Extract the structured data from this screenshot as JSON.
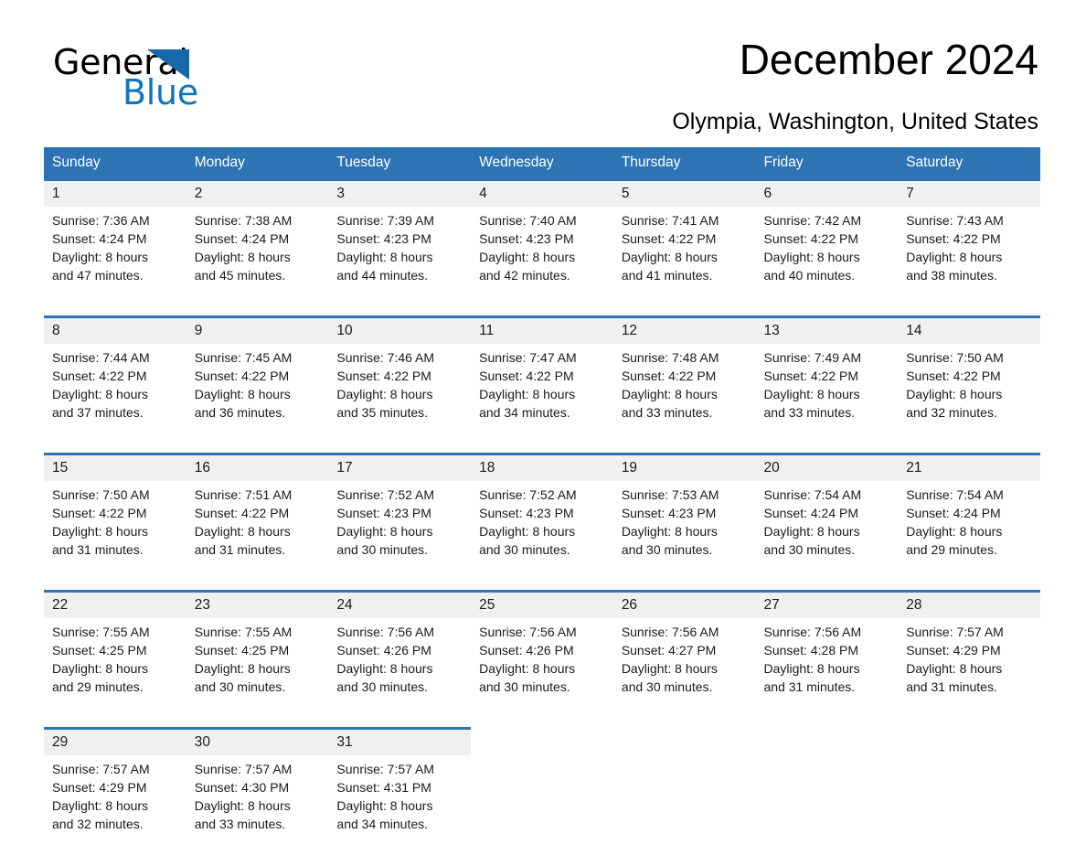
{
  "brand": {
    "word_one": "General",
    "word_two": "Blue",
    "triangle_color": "#0f75bc",
    "logo_icon": "triangle-icon"
  },
  "header": {
    "title": "December 2024",
    "location": "Olympia, Washington, United States"
  },
  "calendar": {
    "accent_color": "#2e74b5",
    "daynum_bg": "#f0f0f0",
    "weekday_headers": [
      "Sunday",
      "Monday",
      "Tuesday",
      "Wednesday",
      "Thursday",
      "Friday",
      "Saturday"
    ],
    "weeks": [
      [
        {
          "day": "1",
          "sunrise": "Sunrise: 7:36 AM",
          "sunset": "Sunset: 4:24 PM",
          "daylight_1": "Daylight: 8 hours",
          "daylight_2": "and 47 minutes."
        },
        {
          "day": "2",
          "sunrise": "Sunrise: 7:38 AM",
          "sunset": "Sunset: 4:24 PM",
          "daylight_1": "Daylight: 8 hours",
          "daylight_2": "and 45 minutes."
        },
        {
          "day": "3",
          "sunrise": "Sunrise: 7:39 AM",
          "sunset": "Sunset: 4:23 PM",
          "daylight_1": "Daylight: 8 hours",
          "daylight_2": "and 44 minutes."
        },
        {
          "day": "4",
          "sunrise": "Sunrise: 7:40 AM",
          "sunset": "Sunset: 4:23 PM",
          "daylight_1": "Daylight: 8 hours",
          "daylight_2": "and 42 minutes."
        },
        {
          "day": "5",
          "sunrise": "Sunrise: 7:41 AM",
          "sunset": "Sunset: 4:22 PM",
          "daylight_1": "Daylight: 8 hours",
          "daylight_2": "and 41 minutes."
        },
        {
          "day": "6",
          "sunrise": "Sunrise: 7:42 AM",
          "sunset": "Sunset: 4:22 PM",
          "daylight_1": "Daylight: 8 hours",
          "daylight_2": "and 40 minutes."
        },
        {
          "day": "7",
          "sunrise": "Sunrise: 7:43 AM",
          "sunset": "Sunset: 4:22 PM",
          "daylight_1": "Daylight: 8 hours",
          "daylight_2": "and 38 minutes."
        }
      ],
      [
        {
          "day": "8",
          "sunrise": "Sunrise: 7:44 AM",
          "sunset": "Sunset: 4:22 PM",
          "daylight_1": "Daylight: 8 hours",
          "daylight_2": "and 37 minutes."
        },
        {
          "day": "9",
          "sunrise": "Sunrise: 7:45 AM",
          "sunset": "Sunset: 4:22 PM",
          "daylight_1": "Daylight: 8 hours",
          "daylight_2": "and 36 minutes."
        },
        {
          "day": "10",
          "sunrise": "Sunrise: 7:46 AM",
          "sunset": "Sunset: 4:22 PM",
          "daylight_1": "Daylight: 8 hours",
          "daylight_2": "and 35 minutes."
        },
        {
          "day": "11",
          "sunrise": "Sunrise: 7:47 AM",
          "sunset": "Sunset: 4:22 PM",
          "daylight_1": "Daylight: 8 hours",
          "daylight_2": "and 34 minutes."
        },
        {
          "day": "12",
          "sunrise": "Sunrise: 7:48 AM",
          "sunset": "Sunset: 4:22 PM",
          "daylight_1": "Daylight: 8 hours",
          "daylight_2": "and 33 minutes."
        },
        {
          "day": "13",
          "sunrise": "Sunrise: 7:49 AM",
          "sunset": "Sunset: 4:22 PM",
          "daylight_1": "Daylight: 8 hours",
          "daylight_2": "and 33 minutes."
        },
        {
          "day": "14",
          "sunrise": "Sunrise: 7:50 AM",
          "sunset": "Sunset: 4:22 PM",
          "daylight_1": "Daylight: 8 hours",
          "daylight_2": "and 32 minutes."
        }
      ],
      [
        {
          "day": "15",
          "sunrise": "Sunrise: 7:50 AM",
          "sunset": "Sunset: 4:22 PM",
          "daylight_1": "Daylight: 8 hours",
          "daylight_2": "and 31 minutes."
        },
        {
          "day": "16",
          "sunrise": "Sunrise: 7:51 AM",
          "sunset": "Sunset: 4:22 PM",
          "daylight_1": "Daylight: 8 hours",
          "daylight_2": "and 31 minutes."
        },
        {
          "day": "17",
          "sunrise": "Sunrise: 7:52 AM",
          "sunset": "Sunset: 4:23 PM",
          "daylight_1": "Daylight: 8 hours",
          "daylight_2": "and 30 minutes."
        },
        {
          "day": "18",
          "sunrise": "Sunrise: 7:52 AM",
          "sunset": "Sunset: 4:23 PM",
          "daylight_1": "Daylight: 8 hours",
          "daylight_2": "and 30 minutes."
        },
        {
          "day": "19",
          "sunrise": "Sunrise: 7:53 AM",
          "sunset": "Sunset: 4:23 PM",
          "daylight_1": "Daylight: 8 hours",
          "daylight_2": "and 30 minutes."
        },
        {
          "day": "20",
          "sunrise": "Sunrise: 7:54 AM",
          "sunset": "Sunset: 4:24 PM",
          "daylight_1": "Daylight: 8 hours",
          "daylight_2": "and 30 minutes."
        },
        {
          "day": "21",
          "sunrise": "Sunrise: 7:54 AM",
          "sunset": "Sunset: 4:24 PM",
          "daylight_1": "Daylight: 8 hours",
          "daylight_2": "and 29 minutes."
        }
      ],
      [
        {
          "day": "22",
          "sunrise": "Sunrise: 7:55 AM",
          "sunset": "Sunset: 4:25 PM",
          "daylight_1": "Daylight: 8 hours",
          "daylight_2": "and 29 minutes."
        },
        {
          "day": "23",
          "sunrise": "Sunrise: 7:55 AM",
          "sunset": "Sunset: 4:25 PM",
          "daylight_1": "Daylight: 8 hours",
          "daylight_2": "and 30 minutes."
        },
        {
          "day": "24",
          "sunrise": "Sunrise: 7:56 AM",
          "sunset": "Sunset: 4:26 PM",
          "daylight_1": "Daylight: 8 hours",
          "daylight_2": "and 30 minutes."
        },
        {
          "day": "25",
          "sunrise": "Sunrise: 7:56 AM",
          "sunset": "Sunset: 4:26 PM",
          "daylight_1": "Daylight: 8 hours",
          "daylight_2": "and 30 minutes."
        },
        {
          "day": "26",
          "sunrise": "Sunrise: 7:56 AM",
          "sunset": "Sunset: 4:27 PM",
          "daylight_1": "Daylight: 8 hours",
          "daylight_2": "and 30 minutes."
        },
        {
          "day": "27",
          "sunrise": "Sunrise: 7:56 AM",
          "sunset": "Sunset: 4:28 PM",
          "daylight_1": "Daylight: 8 hours",
          "daylight_2": "and 31 minutes."
        },
        {
          "day": "28",
          "sunrise": "Sunrise: 7:57 AM",
          "sunset": "Sunset: 4:29 PM",
          "daylight_1": "Daylight: 8 hours",
          "daylight_2": "and 31 minutes."
        }
      ],
      [
        {
          "day": "29",
          "sunrise": "Sunrise: 7:57 AM",
          "sunset": "Sunset: 4:29 PM",
          "daylight_1": "Daylight: 8 hours",
          "daylight_2": "and 32 minutes."
        },
        {
          "day": "30",
          "sunrise": "Sunrise: 7:57 AM",
          "sunset": "Sunset: 4:30 PM",
          "daylight_1": "Daylight: 8 hours",
          "daylight_2": "and 33 minutes."
        },
        {
          "day": "31",
          "sunrise": "Sunrise: 7:57 AM",
          "sunset": "Sunset: 4:31 PM",
          "daylight_1": "Daylight: 8 hours",
          "daylight_2": "and 34 minutes."
        },
        {
          "day": "",
          "sunrise": "",
          "sunset": "",
          "daylight_1": "",
          "daylight_2": ""
        },
        {
          "day": "",
          "sunrise": "",
          "sunset": "",
          "daylight_1": "",
          "daylight_2": ""
        },
        {
          "day": "",
          "sunrise": "",
          "sunset": "",
          "daylight_1": "",
          "daylight_2": ""
        },
        {
          "day": "",
          "sunrise": "",
          "sunset": "",
          "daylight_1": "",
          "daylight_2": ""
        }
      ]
    ]
  }
}
